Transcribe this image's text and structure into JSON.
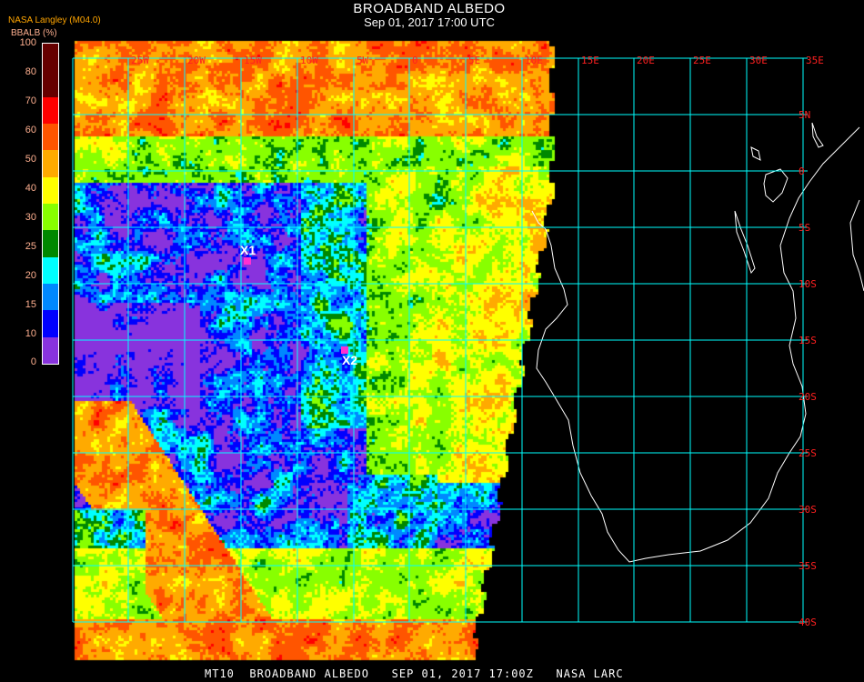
{
  "header": {
    "title": "BROADBAND ALBEDO",
    "subtitle": "Sep 01, 2017 17:00 UTC",
    "producer": "NASA Langley (M04.0)",
    "parameter": "BBALB (%)"
  },
  "colorbar": {
    "ticks": [
      "100",
      "80",
      "70",
      "60",
      "50",
      "40",
      "30",
      "25",
      "20",
      "15",
      "10",
      "0"
    ],
    "bins": [
      {
        "min": 80,
        "max": 100,
        "color": "#660000"
      },
      {
        "min": 70,
        "max": 80,
        "color": "#ff0000"
      },
      {
        "min": 60,
        "max": 70,
        "color": "#ff5500"
      },
      {
        "min": 50,
        "max": 60,
        "color": "#ffaa00"
      },
      {
        "min": 40,
        "max": 50,
        "color": "#ffff00"
      },
      {
        "min": 30,
        "max": 40,
        "color": "#88ff00"
      },
      {
        "min": 25,
        "max": 30,
        "color": "#008800"
      },
      {
        "min": 20,
        "max": 25,
        "color": "#00ffff"
      },
      {
        "min": 15,
        "max": 20,
        "color": "#0088ff"
      },
      {
        "min": 10,
        "max": 15,
        "color": "#0000ff"
      },
      {
        "min": 0,
        "max": 10,
        "color": "#8833dd"
      }
    ]
  },
  "grid": {
    "longitude_labels": [
      "25W",
      "20W",
      "15W",
      "10W",
      "5W",
      "0",
      "5E",
      "10E",
      "15E",
      "20E",
      "25E",
      "30E",
      "35E"
    ],
    "latitude_labels": [
      "5N",
      "0",
      "5S",
      "10S",
      "15S",
      "20S",
      "25S",
      "30S",
      "35S",
      "40S"
    ],
    "color": "#00ffff",
    "label_color": "#ff2020"
  },
  "markers": [
    {
      "label": "X1"
    },
    {
      "label": "X2"
    }
  ],
  "footer": "MT10  BROADBAND ALBEDO   SEP 01, 2017 17:00Z   NASA LARC"
}
